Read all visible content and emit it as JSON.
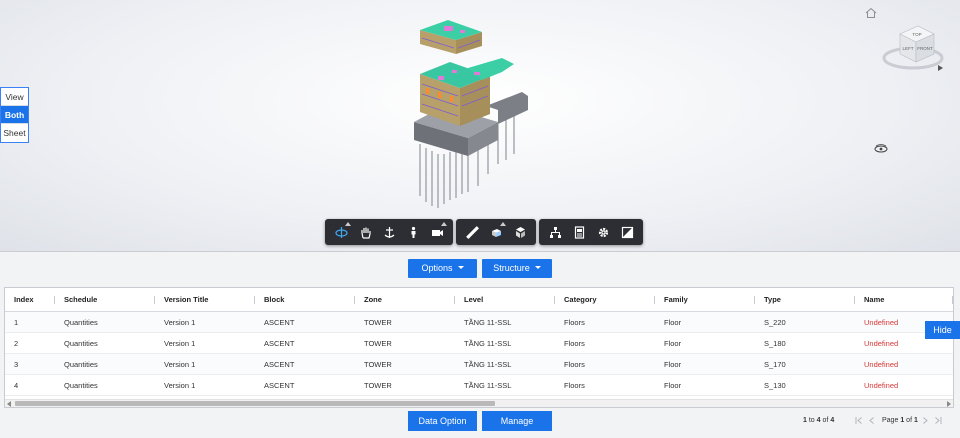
{
  "viewer": {
    "view_toggle": [
      "View",
      "Both",
      "Sheet"
    ],
    "active_toggle": "Both",
    "viewcube": {
      "top_label": "TOP",
      "left_label": "LEFT",
      "front_label": "FRONT"
    },
    "toolbar": {
      "group1": [
        "orbit-icon",
        "pan-icon",
        "dolly-icon",
        "first-person-icon",
        "camera-icon"
      ],
      "group2": [
        "measure-icon",
        "section-icon",
        "explode-icon"
      ],
      "group3": [
        "model-browser-icon",
        "properties-icon",
        "settings-icon",
        "fullscreen-icon"
      ]
    }
  },
  "controls": {
    "options_label": "Options",
    "structure_label": "Structure",
    "hide_label": "Hide",
    "data_option_label": "Data Option",
    "manage_label": "Manage"
  },
  "table": {
    "columns": [
      "Index",
      "Schedule",
      "Version Title",
      "Block",
      "Zone",
      "Level",
      "Category",
      "Family",
      "Type",
      "Name"
    ],
    "rows": [
      [
        "1",
        "Quantities",
        "Version 1",
        "ASCENT",
        "TOWER",
        "TẦNG 11-SSL",
        "Floors",
        "Floor",
        "S_220",
        "Undefined"
      ],
      [
        "2",
        "Quantities",
        "Version 1",
        "ASCENT",
        "TOWER",
        "TẦNG 11-SSL",
        "Floors",
        "Floor",
        "S_180",
        "Undefined"
      ],
      [
        "3",
        "Quantities",
        "Version 1",
        "ASCENT",
        "TOWER",
        "TẦNG 11-SSL",
        "Floors",
        "Floor",
        "S_170",
        "Undefined"
      ],
      [
        "4",
        "Quantities",
        "Version 1",
        "ASCENT",
        "TOWER",
        "TẦNG 11-SSL",
        "Floors",
        "Floor",
        "S_130",
        "Undefined"
      ]
    ]
  },
  "pagination": {
    "range_start": "1",
    "to_word": "to",
    "range_end": "4",
    "of_word": "of",
    "total": "4",
    "page_word": "Page",
    "page": "1",
    "page_of_word": "of",
    "pages": "1"
  },
  "colors": {
    "accent": "#1a73e8",
    "toolbar_bg": "#2c2e33",
    "undefined_text": "#d93838"
  }
}
